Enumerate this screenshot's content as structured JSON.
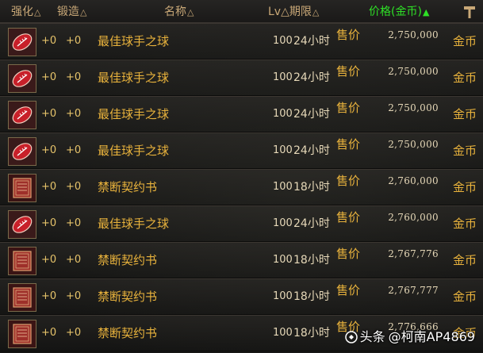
{
  "header": {
    "qianghua": "强化",
    "duanzao": "锻造",
    "mingcheng": "名称",
    "lv_qixian": "Lv△期限",
    "jiage": "价格(金币)",
    "sort_tri": "△",
    "sort_active": "▲"
  },
  "rows": [
    {
      "icon": "football-item-icon",
      "qh": "+0",
      "dz": "+0",
      "name": "最佳球手之球",
      "lv": "100",
      "duration": "24小时",
      "sell": "售价",
      "price": "2,750,000",
      "currency": "金币"
    },
    {
      "icon": "football-item-icon",
      "qh": "+0",
      "dz": "+0",
      "name": "最佳球手之球",
      "lv": "100",
      "duration": "24小时",
      "sell": "售价",
      "price": "2,750,000",
      "currency": "金币"
    },
    {
      "icon": "football-item-icon",
      "qh": "+0",
      "dz": "+0",
      "name": "最佳球手之球",
      "lv": "100",
      "duration": "24小时",
      "sell": "售价",
      "price": "2,750,000",
      "currency": "金币"
    },
    {
      "icon": "football-item-icon",
      "qh": "+0",
      "dz": "+0",
      "name": "最佳球手之球",
      "lv": "100",
      "duration": "24小时",
      "sell": "售价",
      "price": "2,750,000",
      "currency": "金币"
    },
    {
      "icon": "contract-book-icon",
      "qh": "+0",
      "dz": "+0",
      "name": "禁断契约书",
      "lv": "100",
      "duration": "18小时",
      "sell": "售价",
      "price": "2,760,000",
      "currency": "金币"
    },
    {
      "icon": "football-item-icon",
      "qh": "+0",
      "dz": "+0",
      "name": "最佳球手之球",
      "lv": "100",
      "duration": "24小时",
      "sell": "售价",
      "price": "2,760,000",
      "currency": "金币"
    },
    {
      "icon": "contract-book-icon",
      "qh": "+0",
      "dz": "+0",
      "name": "禁断契约书",
      "lv": "100",
      "duration": "18小时",
      "sell": "售价",
      "price": "2,767,776",
      "currency": "金币"
    },
    {
      "icon": "contract-book-icon",
      "qh": "+0",
      "dz": "+0",
      "name": "禁断契约书",
      "lv": "100",
      "duration": "18小时",
      "sell": "售价",
      "price": "2,767,777",
      "currency": "金币"
    },
    {
      "icon": "contract-book-icon",
      "qh": "+0",
      "dz": "+0",
      "name": "禁断契约书",
      "lv": "100",
      "duration": "18小时",
      "sell": "售价",
      "price": "2,776,666",
      "currency": "金币"
    }
  ],
  "watermark": {
    "source": "头条",
    "author": "@柯南AP4869"
  },
  "colors": {
    "gold_text": "#e8b23c",
    "header_text": "#c9a877",
    "active_sort": "#2ee026",
    "value_text": "#e6d8b8"
  }
}
